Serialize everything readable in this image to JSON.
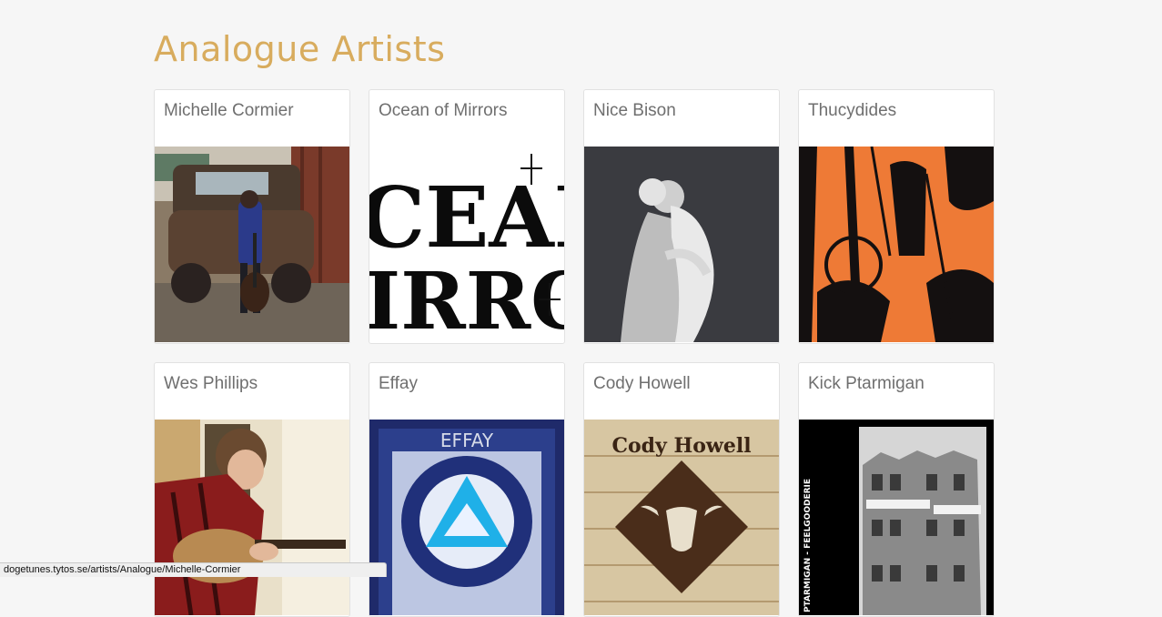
{
  "page": {
    "title": "Analogue Artists"
  },
  "artists": [
    {
      "name": "Michelle Cormier",
      "art": "photo-woman-with-guitar-by-truck"
    },
    {
      "name": "Ocean of Mirrors",
      "art": "black-white-typographic-logo"
    },
    {
      "name": "Nice Bison",
      "art": "photo-couple-dancing"
    },
    {
      "name": "Thucydides",
      "art": "greek-red-figure-pottery"
    },
    {
      "name": "Wes Phillips",
      "art": "photo-man-playing-guitar"
    },
    {
      "name": "Effay",
      "art": "blue-triangle-circle-cover",
      "cover_text": "EFFAY"
    },
    {
      "name": "Cody Howell",
      "art": "wood-skull-diamond-cover",
      "cover_text": "Cody Howell"
    },
    {
      "name": "Kick Ptarmigan",
      "art": "building-photo-cover",
      "cover_text": "PTARMIGAN - FEELGOODERIE"
    }
  ],
  "status_bar": {
    "url": "dogetunes.tytos.se/artists/Analogue/Michelle-Cormier"
  },
  "colors": {
    "title": "#d8ac5e",
    "card_border": "#e2e2e2",
    "name_text": "#6f6f6f",
    "background": "#f6f6f6"
  }
}
